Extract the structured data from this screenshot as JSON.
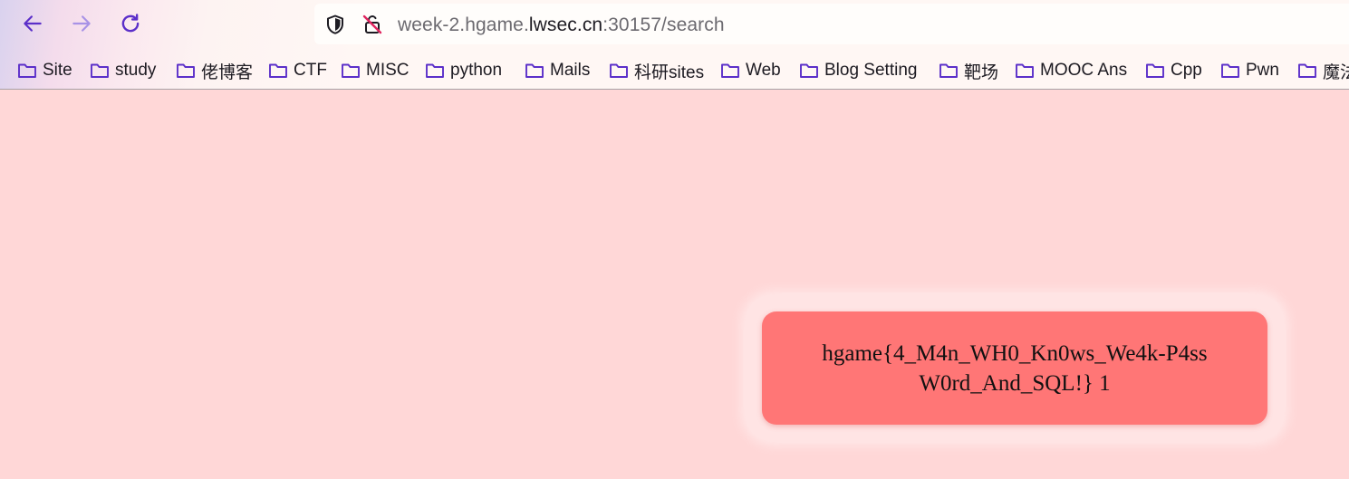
{
  "browser": {
    "url": {
      "prefix": "week-2.hgame.",
      "domain": "lwsec.cn",
      "suffix": ":30157/search"
    },
    "bookmarks": [
      {
        "label": "Site"
      },
      {
        "label": "study"
      },
      {
        "label": "佬博客"
      },
      {
        "label": "CTF"
      },
      {
        "label": "MISC"
      },
      {
        "label": "python"
      },
      {
        "label": "Mails"
      },
      {
        "label": "科研sites"
      },
      {
        "label": "Web"
      },
      {
        "label": "Blog Setting"
      },
      {
        "label": "靶场"
      },
      {
        "label": "MOOC Ans"
      },
      {
        "label": "Cpp"
      },
      {
        "label": "Pwn"
      },
      {
        "label": "魔法"
      }
    ],
    "icons": {
      "back": "arrow-left-icon",
      "forward": "arrow-right-icon",
      "reload": "reload-icon",
      "shield": "shield-icon",
      "lock": "insecure-lock-icon",
      "folder": "folder-icon"
    },
    "accent_color": "#5b2fc9",
    "insecure_color": "#e0245e"
  },
  "page": {
    "background_color": "#ffd7d7",
    "card_color": "#ff7676",
    "result_text": "hgame{4_M4n_WH0_Kn0ws_We4k-P4ssW0rd_And_SQL!} 1"
  }
}
